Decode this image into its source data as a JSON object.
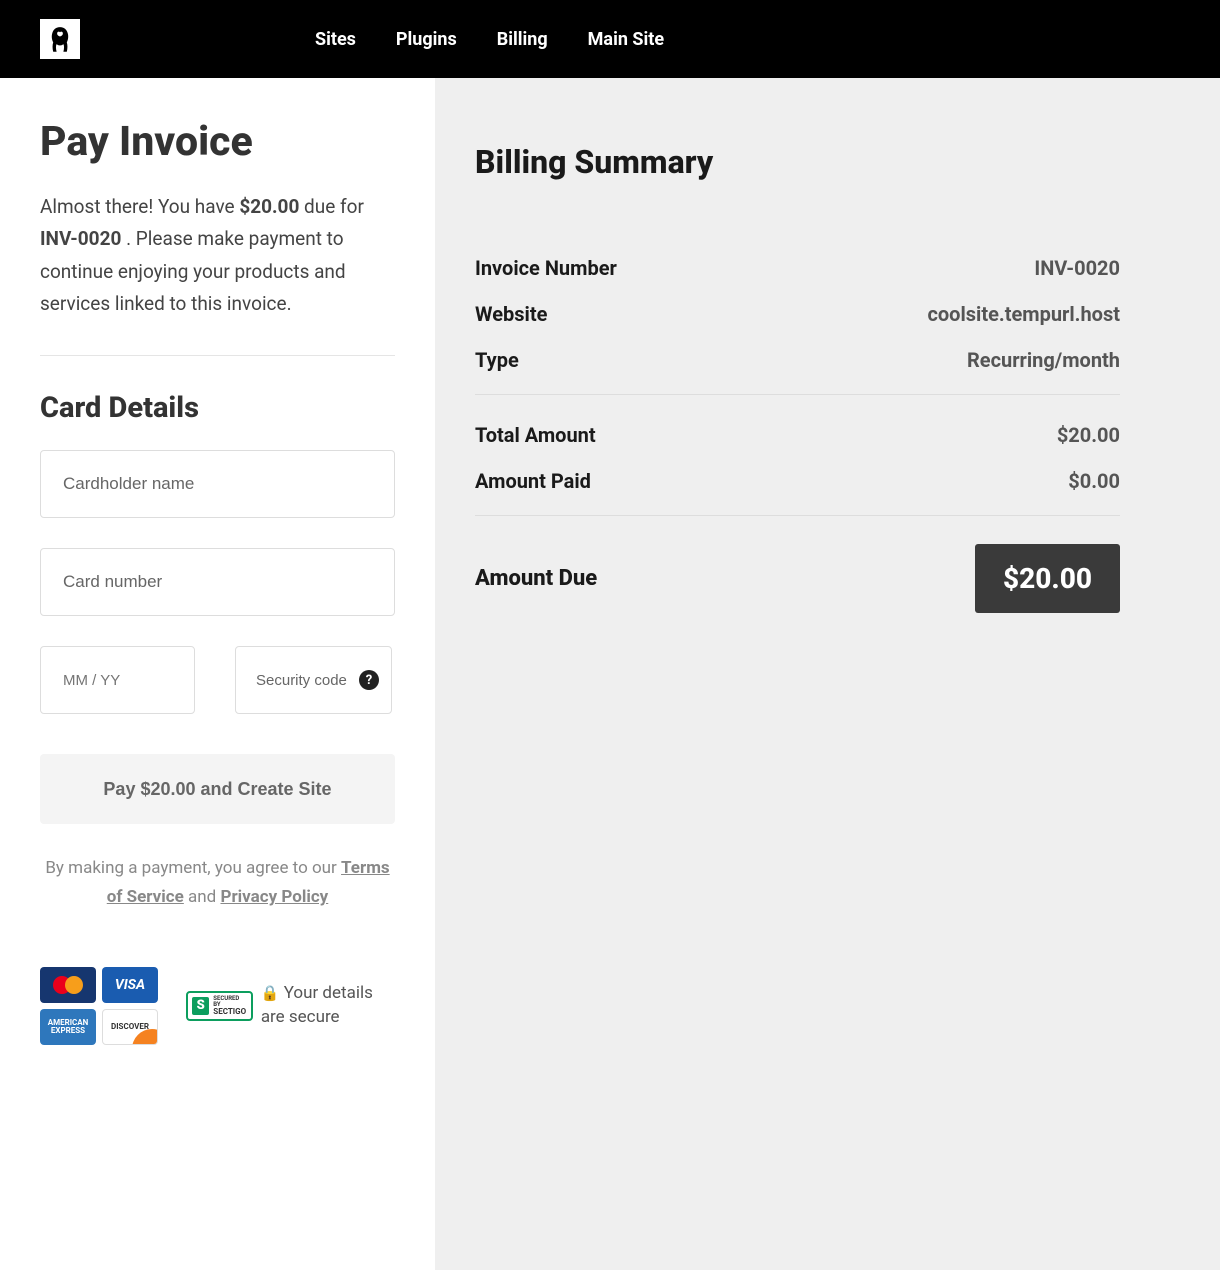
{
  "nav": {
    "items": [
      "Sites",
      "Plugins",
      "Billing",
      "Main Site"
    ]
  },
  "pay": {
    "title": "Pay Invoice",
    "intro_pre": "Almost there! You have ",
    "intro_amount": "$20.00",
    "intro_mid": " due for ",
    "intro_inv": "INV-0020",
    "intro_post": " . Please make payment to continue enjoying your products and services linked to this invoice."
  },
  "card": {
    "title": "Card Details",
    "name_placeholder": "Cardholder name",
    "number_placeholder": "Card number",
    "expiry_placeholder": "MM / YY",
    "security_placeholder": "Security code"
  },
  "button": {
    "label": "Pay $20.00 and Create Site"
  },
  "agreement": {
    "pre": "By making a payment, you agree to our ",
    "tos": "Terms of Service",
    "mid": " and ",
    "pp": "Privacy Policy"
  },
  "trust": {
    "secured_by": "SECURED BY",
    "sectigo": "SECTIGO",
    "secure_text": "Your details are secure",
    "cards": {
      "mastercard": "MasterCard",
      "visa": "VISA",
      "amex": "AMERICAN EXPRESS",
      "discover": "DISCOVER"
    }
  },
  "summary": {
    "title": "Billing Summary",
    "rows": [
      {
        "label": "Invoice Number",
        "value": "INV-0020"
      },
      {
        "label": "Website",
        "value": "coolsite.tempurl.host"
      },
      {
        "label": "Type",
        "value": "Recurring/month"
      }
    ],
    "totals": [
      {
        "label": "Total Amount",
        "value": "$20.00"
      },
      {
        "label": "Amount Paid",
        "value": "$0.00"
      }
    ],
    "due_label": "Amount Due",
    "due_value": "$20.00"
  }
}
